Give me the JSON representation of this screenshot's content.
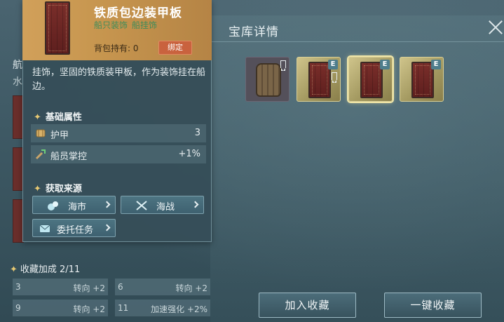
{
  "treasury": {
    "title": "宝库详情",
    "slots": [
      {
        "kind": "barrel",
        "badge": "",
        "bookmark": true
      },
      {
        "kind": "plate",
        "badge": "E",
        "bookmark": true
      },
      {
        "kind": "plate",
        "badge": "E",
        "bookmark": false,
        "selected": true
      },
      {
        "kind": "plate",
        "badge": "E",
        "bookmark": false
      }
    ],
    "add_button": "加入收藏",
    "all_button": "一键收藏"
  },
  "left": {
    "label_1": "航",
    "label_2": "水",
    "bonus_title": "收藏加成 2/11",
    "bonus": [
      {
        "num": "3",
        "text": "转向 +2"
      },
      {
        "num": "6",
        "text": "转向 +2"
      },
      {
        "num": "9",
        "text": "转向 +2"
      },
      {
        "num": "11",
        "text": "加速强化 +2%"
      }
    ]
  },
  "item": {
    "name": "铁质包边装甲板",
    "tags": [
      "船只装饰",
      "船挂饰"
    ],
    "hold_label": "背包持有: 0",
    "bind_label": "绑定",
    "description": "挂饰，坚固的铁质装甲板，作为装饰挂在船边。",
    "attr_section": "基础属性",
    "attributes": [
      {
        "name": "护甲",
        "value": "3",
        "icon": "armor-icon"
      },
      {
        "name": "船员掌控",
        "value": "+1%",
        "icon": "crew-control-icon"
      }
    ],
    "source_section": "获取来源",
    "sources": [
      {
        "label": "海市",
        "icon": "market-icon"
      },
      {
        "label": "海战",
        "icon": "crossed-swords-icon"
      },
      {
        "label": "委托任务",
        "icon": "commission-icon"
      }
    ]
  },
  "colors": {
    "accent_gold": "#e8c972",
    "tag_green": "#3e8c5a",
    "bind_orange": "#c9623e"
  }
}
